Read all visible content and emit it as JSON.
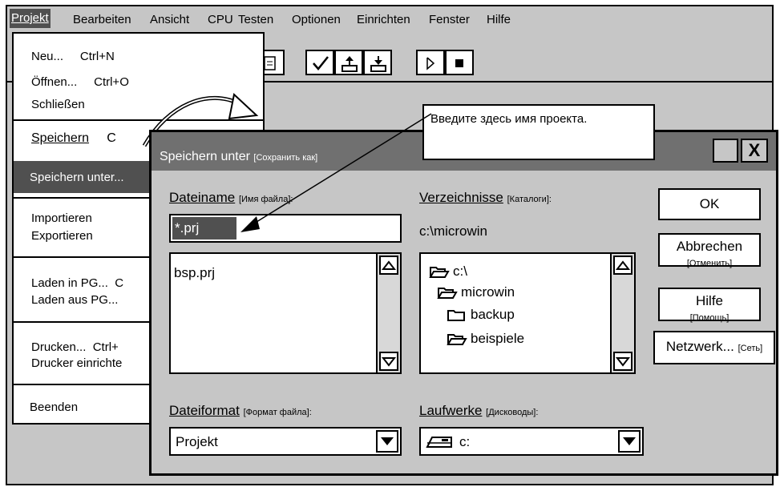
{
  "menubar": {
    "items": [
      {
        "label": "Projekt"
      },
      {
        "label": "Bearbeiten"
      },
      {
        "label": "Ansicht"
      },
      {
        "label": "CPU"
      },
      {
        "label": "Testen"
      },
      {
        "label": "Optionen"
      },
      {
        "label": "Einrichten"
      },
      {
        "label": "Fenster"
      },
      {
        "label": "Hilfe"
      }
    ]
  },
  "dropdown": {
    "items": [
      {
        "label": "Neu...",
        "shortcut": "Ctrl+N"
      },
      {
        "label": "Öffnen...",
        "shortcut": "Ctrl+O"
      },
      {
        "label": "Schließen"
      },
      {
        "label": "Speichern",
        "shortcut": "C"
      },
      {
        "label": "Speichern unter..."
      },
      {
        "label": "Importieren"
      },
      {
        "label": "Exportieren"
      },
      {
        "label": "Laden in PG...",
        "shortcut": "C"
      },
      {
        "label": "Laden aus PG..."
      },
      {
        "label": "Drucken...",
        "shortcut": "Ctrl+"
      },
      {
        "label": "Drucker einrichte"
      },
      {
        "label": "Beenden"
      }
    ]
  },
  "tooltip": {
    "text": "Введите здесь имя проекта."
  },
  "dialog": {
    "title": "Speichern unter",
    "title_note": "[Сохранить как]",
    "close_label": "X",
    "filename": {
      "label": "Dateiname",
      "note": "[Имя файла]:",
      "value": "*.prj",
      "files": [
        "bsp.prj"
      ]
    },
    "directories": {
      "label": "Verzeichnisse",
      "note": "[Каталоги]:",
      "current": "c:\\microwin",
      "tree": [
        {
          "label": "c:\\",
          "icon": "open-folder-icon"
        },
        {
          "label": "microwin",
          "icon": "open-folder-icon"
        },
        {
          "label": "backup",
          "icon": "closed-folder-icon"
        },
        {
          "label": "beispiele",
          "icon": "open-folder-icon"
        }
      ]
    },
    "fileformat": {
      "label": "Dateiformat",
      "note": "[Формат файла]:",
      "value": "Projekt"
    },
    "drives": {
      "label": "Laufwerke",
      "note": "[Дисководы]:",
      "value": "c:"
    },
    "buttons": {
      "ok": "OK",
      "cancel": "Abbrechen",
      "cancel_note": "[Отменить]",
      "help": "Hilfe",
      "help_note": "[Помощь]",
      "network": "Netzwerk...",
      "network_note": "[Сеть]"
    }
  }
}
